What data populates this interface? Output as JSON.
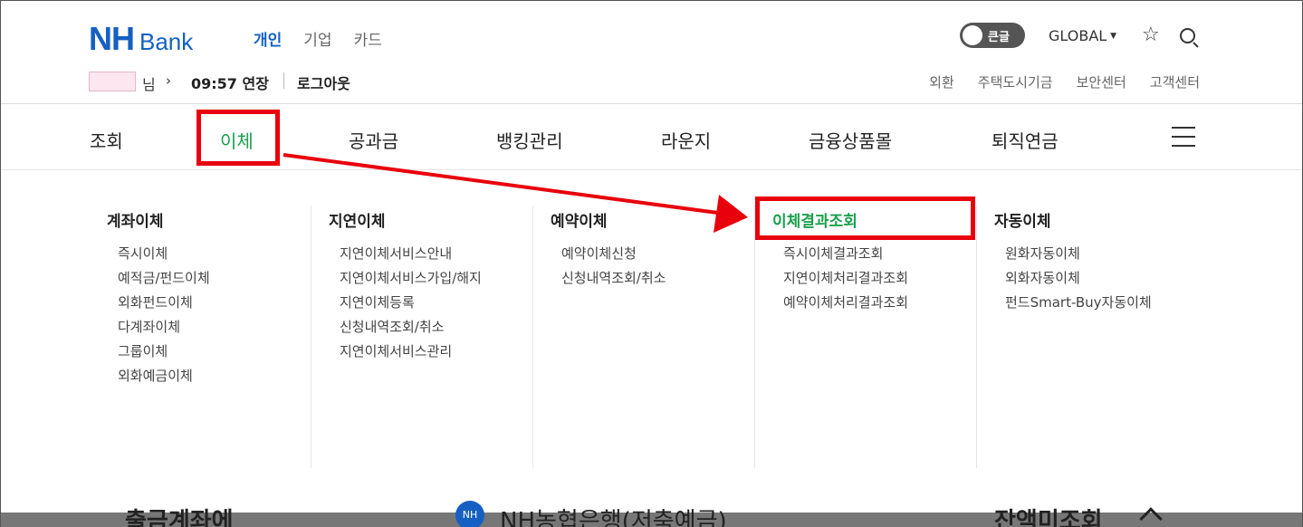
{
  "header": {
    "logo_nh": "NH",
    "logo_bank": "Bank",
    "top_nav": [
      {
        "label": "개인",
        "active": true
      },
      {
        "label": "기업",
        "active": false
      },
      {
        "label": "카드",
        "active": false
      }
    ],
    "toggle_label": "큰글",
    "global_label": "GLOBAL",
    "icons": {
      "star": "star-icon",
      "search": "search-icon"
    }
  },
  "session": {
    "user_suffix": "님",
    "timer": "09:57 연장",
    "logout": "로그아웃"
  },
  "utility_links": [
    "외환",
    "주택도시기금",
    "보안센터",
    "고객센터"
  ],
  "main_nav": [
    {
      "label": "조회",
      "active": false
    },
    {
      "label": "이체",
      "active": true
    },
    {
      "label": "공과금",
      "active": false
    },
    {
      "label": "뱅킹관리",
      "active": false
    },
    {
      "label": "라운지",
      "active": false
    },
    {
      "label": "금융상품몰",
      "active": false
    },
    {
      "label": "퇴직연금",
      "active": false
    }
  ],
  "menu_columns": [
    {
      "title": "계좌이체",
      "items": [
        "즉시이체",
        "예적금/펀드이체",
        "외화펀드이체",
        "다계좌이체",
        "그룹이체",
        "외화예금이체"
      ]
    },
    {
      "title": "지연이체",
      "items": [
        "지연이체서비스안내",
        "지연이체서비스가입/해지",
        "지연이체등록",
        "신청내역조회/취소",
        "지연이체서비스관리"
      ]
    },
    {
      "title": "예약이체",
      "items": [
        "예약이체신청",
        "신청내역조회/취소"
      ]
    },
    {
      "title": "이체결과조회",
      "highlighted": true,
      "items": [
        "즉시이체결과조회",
        "지연이체처리결과조회",
        "예약이체처리결과조회"
      ]
    },
    {
      "title": "자동이체",
      "items": [
        "원화자동이체",
        "외화자동이체",
        "펀드Smart-Buy자동이체"
      ]
    }
  ],
  "colors": {
    "brand_blue": "#1560c2",
    "active_green": "#1aa04b",
    "annotation_red": "#e8000c"
  },
  "background_peek": {
    "left_text": "출금계좌에",
    "badge": "NH",
    "middle_text": "NH농협은행(저축예금)",
    "right_text": "잔액미조회"
  }
}
